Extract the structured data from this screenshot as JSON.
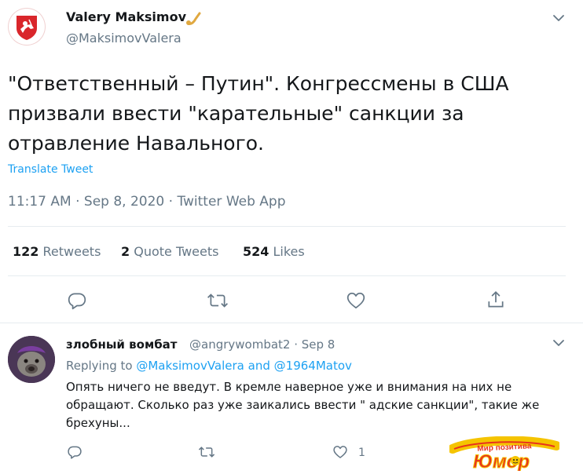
{
  "tweet": {
    "display_name": "Valery Maksimov",
    "handle": "@MaksimovValera",
    "text": "\"Ответственный – Путин\". Конгрессмены в США призвали ввести \"карательные\" санкции за отравление Навального.",
    "translate_label": "Translate Tweet",
    "timestamp": "11:17 AM · Sep 8, 2020 · Twitter Web App",
    "stats": {
      "retweets_count": "122",
      "retweets_label": "Retweets",
      "quotes_count": "2",
      "quotes_label": "Quote Tweets",
      "likes_count": "524",
      "likes_label": "Likes"
    }
  },
  "reply": {
    "display_name": "злобный вомбат",
    "handle_date": "@angrywombat2 · Sep 8",
    "replying_prefix": "Replying to",
    "mention_1": "@MaksimovValera",
    "and_word": "and",
    "mention_2": "@1964Matov",
    "text": "Опять ничего не введут. В кремле наверное уже и внимания на них не обращают. Сколько раз уже заикались ввести \" адские санкции\",  такие же брехуны...",
    "like_count": "1"
  },
  "watermark": {
    "line1": "Мир позитива",
    "line2": "Юмор"
  },
  "colors": {
    "accent": "#1da1f2",
    "muted": "#657786",
    "text": "#14171a"
  }
}
